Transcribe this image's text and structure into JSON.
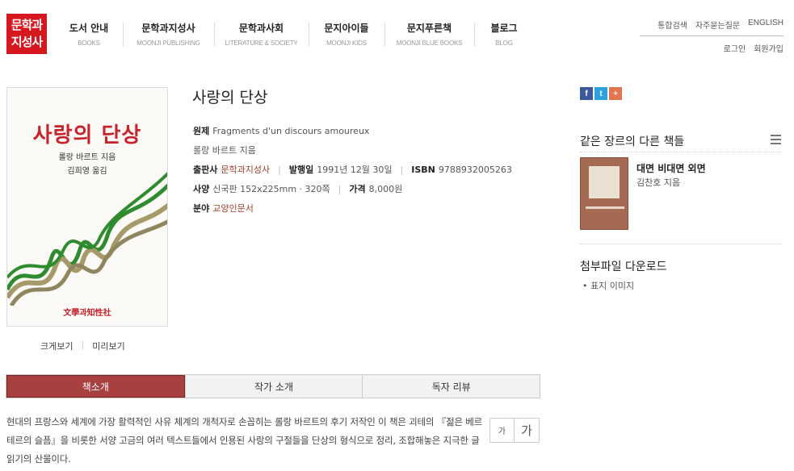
{
  "logo": {
    "line1": "문학과",
    "line2": "지성사"
  },
  "nav": [
    {
      "ko": "도서 안내",
      "en": "BOOKS"
    },
    {
      "ko": "문학과지성사",
      "en": "MOONJI PUBLISHING"
    },
    {
      "ko": "문학과사회",
      "en": "LITERATURE & SOCIETY"
    },
    {
      "ko": "문지아이들",
      "en": "MOONJI KIDS"
    },
    {
      "ko": "문지푸른책",
      "en": "MOONJI BLUE BOOKS"
    },
    {
      "ko": "블로그",
      "en": "BLOG"
    }
  ],
  "util": {
    "search": "통합검색",
    "faq": "자주묻는질문",
    "english": "ENGLISH",
    "login": "로그인",
    "signup": "회원가입"
  },
  "cover": {
    "title": "사랑의 단상",
    "line1": "롤랑 바르트 지음",
    "line2": "김희영 옮김",
    "publisher": "文學과知性社"
  },
  "cover_links": {
    "zoom": "크게보기",
    "preview": "미리보기"
  },
  "book": {
    "title": "사랑의 단상",
    "orig_label": "원제",
    "orig_value": "Fragments d'un discours amoureux",
    "author": "롤랑 바르트 지음",
    "publisher_label": "출판사",
    "publisher_value": "문학과지성사",
    "date_label": "발행일",
    "date_value": "1991년 12월 30일",
    "isbn_label": "ISBN",
    "isbn_value": "9788932005263",
    "spec_label": "사양",
    "spec_value": "신국판 152x225mm · 320쪽",
    "price_label": "가격",
    "price_value": "8,000원",
    "field_label": "분야",
    "field_value": "교양인문서"
  },
  "share": {
    "facebook": "f",
    "twitter": "t",
    "plus": "+"
  },
  "sidebar": {
    "related_heading": "같은 장르의 다른 책들",
    "related_title": "대면 비대면 외면",
    "related_author": "김찬호 지음",
    "attach_heading": "첨부파일 다운로드",
    "attach_item": "• 표지 이미지"
  },
  "tabs": [
    "책소개",
    "작가 소개",
    "독자 리뷰"
  ],
  "intro": "현대의 프랑스와 세계에 가장 활력적인 사유 체계의 개척자로 손꼽히는 롤랑 바르트의 후기 저작인 이 책은 괴테의 『젊은 베르테르의 슬픔』을 비롯한 서양 고금의 여러 텍스트들에서 인용된 사랑의 구절들을 단상의 형식으로 정리, 조합해놓은 지극한 글읽기의 산물이다.",
  "font_buttons": {
    "small": "가",
    "large": "가"
  },
  "colors": {
    "brand_red": "#d7171f",
    "tab_active": "#a8403f",
    "link_red": "#a0412d"
  }
}
